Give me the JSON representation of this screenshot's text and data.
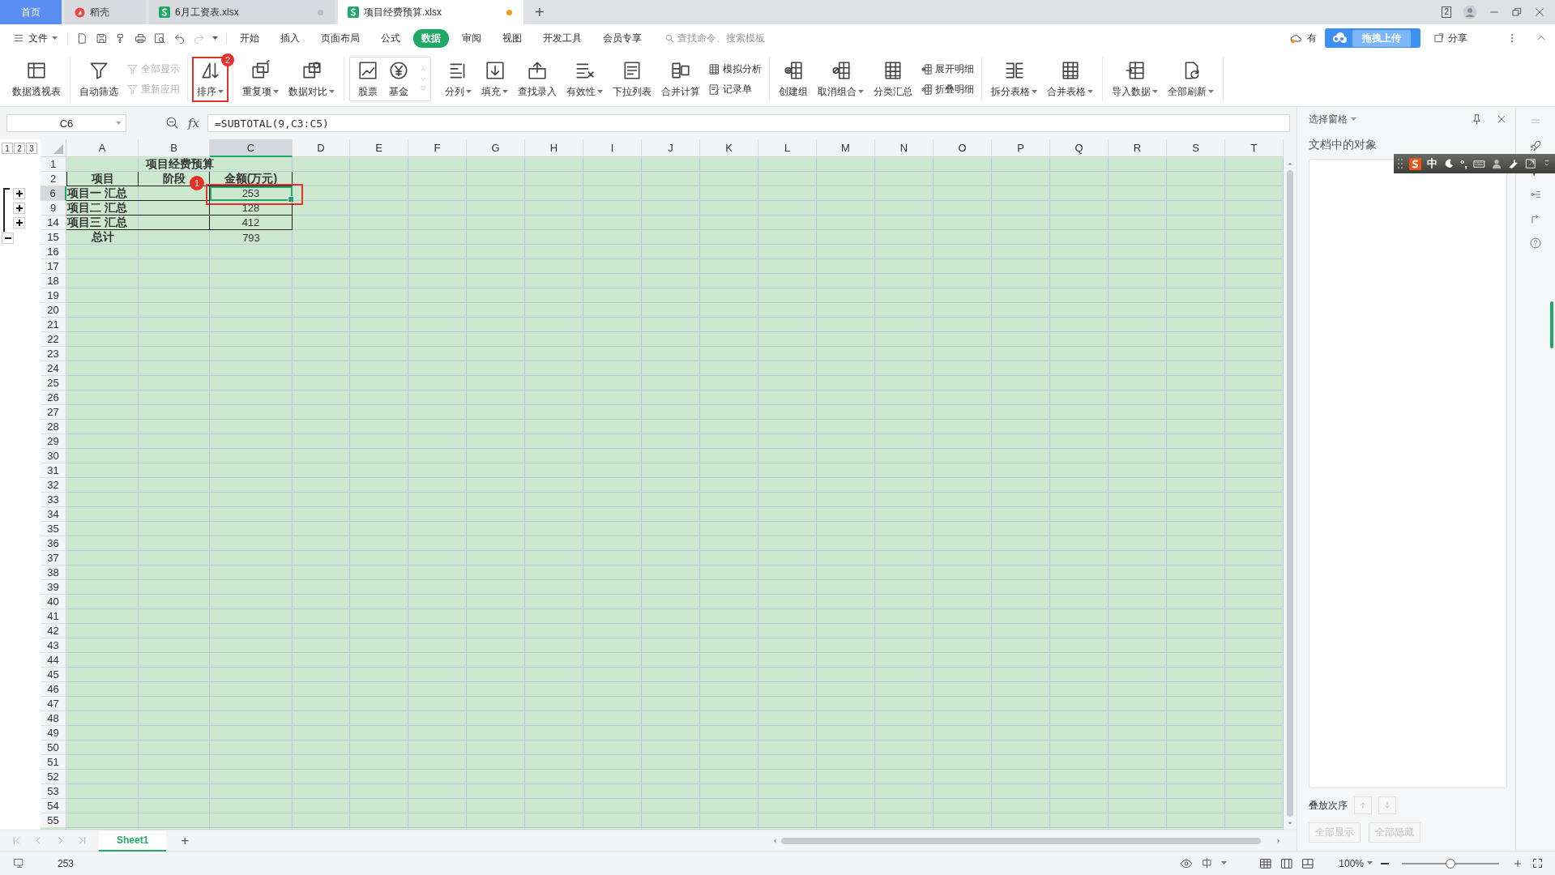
{
  "tabs": [
    {
      "label": "首页",
      "kind": "home",
      "selected": false
    },
    {
      "label": "稻壳",
      "kind": "docer",
      "selected": false
    },
    {
      "label": "6月工资表.xlsx",
      "kind": "sheet",
      "selected": false,
      "modified": false
    },
    {
      "label": "项目经费预算.xlsx",
      "kind": "sheet",
      "selected": true,
      "modified": true
    }
  ],
  "new_tab": "+",
  "window_count": "2",
  "file_menu": "文件",
  "ribbon_tabs": [
    {
      "label": "开始",
      "selected": false
    },
    {
      "label": "插入",
      "selected": false
    },
    {
      "label": "页面布局",
      "selected": false
    },
    {
      "label": "公式",
      "selected": false
    },
    {
      "label": "数据",
      "selected": true
    },
    {
      "label": "审阅",
      "selected": false
    },
    {
      "label": "视图",
      "selected": false
    },
    {
      "label": "开发工具",
      "selected": false
    },
    {
      "label": "会员专享",
      "selected": false
    }
  ],
  "search": {
    "placeholder": "查找命令、搜索模板"
  },
  "sync_status": "有",
  "upload_tip": "拖拽上传",
  "share": "分享",
  "ribbon": [
    {
      "kind": "plain",
      "items": [
        {
          "label": "数据透视表",
          "kind": "large"
        }
      ]
    },
    {
      "kind": "plain",
      "items": [
        {
          "label": "自动筛选",
          "kind": "large"
        },
        {
          "label": "全部显示",
          "kind": "small",
          "disabled": true
        },
        {
          "label": "重新应用",
          "kind": "small",
          "disabled": true
        }
      ]
    },
    {
      "kind": "plain",
      "items": [
        {
          "label": "排序",
          "kind": "large",
          "dropdown": true,
          "callout": "2"
        }
      ]
    },
    {
      "kind": "plain",
      "items": [
        {
          "label": "重复项",
          "kind": "large",
          "dropdown": true
        },
        {
          "label": "数据对比",
          "kind": "large",
          "dropdown": true
        }
      ]
    },
    {
      "kind": "gallery",
      "items": [
        {
          "label": "股票",
          "kind": "large"
        },
        {
          "label": "基金",
          "kind": "large"
        }
      ]
    },
    {
      "kind": "plain",
      "items": [
        {
          "label": "分列",
          "kind": "large",
          "dropdown": true
        },
        {
          "label": "填充",
          "kind": "large",
          "dropdown": true
        },
        {
          "label": "查找录入",
          "kind": "large"
        },
        {
          "label": "有效性",
          "kind": "large",
          "dropdown": true
        },
        {
          "label": "下拉列表",
          "kind": "large"
        },
        {
          "label": "合并计算",
          "kind": "large"
        },
        {
          "label": "模拟分析",
          "kind": "small"
        },
        {
          "label": "记录单",
          "kind": "small"
        }
      ]
    },
    {
      "kind": "plain",
      "items": [
        {
          "label": "创建组",
          "kind": "large"
        },
        {
          "label": "取消组合",
          "kind": "large",
          "dropdown": true
        },
        {
          "label": "分类汇总",
          "kind": "large"
        },
        {
          "label": "展开明细",
          "kind": "small"
        },
        {
          "label": "折叠明细",
          "kind": "small"
        }
      ]
    },
    {
      "kind": "plain",
      "items": [
        {
          "label": "拆分表格",
          "kind": "large",
          "dropdown": true
        },
        {
          "label": "合并表格",
          "kind": "large",
          "dropdown": true
        }
      ]
    },
    {
      "kind": "plain",
      "items": [
        {
          "label": "导入数据",
          "kind": "large",
          "dropdown": true
        },
        {
          "label": "全部刷新",
          "kind": "large",
          "dropdown": true
        }
      ]
    }
  ],
  "formula_bar": {
    "name_box": "C6",
    "function_label": "fx",
    "formula": "=SUBTOTAL(9,C3:C5)"
  },
  "sheet": {
    "outline_levels": [
      "1",
      "2",
      "3"
    ],
    "columns": [
      {
        "label": "A",
        "selected": false
      },
      {
        "label": "B",
        "selected": false
      },
      {
        "label": "C",
        "selected": true
      },
      {
        "label": "D",
        "selected": false
      },
      {
        "label": "E",
        "selected": false
      },
      {
        "label": "F",
        "selected": false
      },
      {
        "label": "G",
        "selected": false
      },
      {
        "label": "H",
        "selected": false
      },
      {
        "label": "I",
        "selected": false
      },
      {
        "label": "J",
        "selected": false
      },
      {
        "label": "K",
        "selected": false
      },
      {
        "label": "L",
        "selected": false
      },
      {
        "label": "M",
        "selected": false
      },
      {
        "label": "N",
        "selected": false
      },
      {
        "label": "O",
        "selected": false
      },
      {
        "label": "P",
        "selected": false
      },
      {
        "label": "Q",
        "selected": false
      },
      {
        "label": "R",
        "selected": false
      },
      {
        "label": "S",
        "selected": false
      },
      {
        "label": "T",
        "selected": false
      }
    ],
    "rows": [
      {
        "number": "1",
        "kind": "title",
        "selected": false,
        "cells": [
          "项目经费预算"
        ]
      },
      {
        "number": "2",
        "kind": "header",
        "selected": false,
        "cells": [
          "项目",
          "阶段",
          "金额(万元)"
        ]
      },
      {
        "number": "6",
        "kind": "data",
        "selected": true,
        "collapsed": true,
        "callout": "1",
        "cells": [
          "项目一  汇总",
          null,
          "253"
        ]
      },
      {
        "number": "9",
        "kind": "data",
        "selected": false,
        "collapsed": true,
        "cells": [
          "项目二  汇总",
          null,
          "128"
        ]
      },
      {
        "number": "14",
        "kind": "data",
        "selected": false,
        "collapsed": true,
        "cells": [
          "项目三  汇总",
          null,
          "412"
        ]
      },
      {
        "number": "15",
        "kind": "total",
        "selected": false,
        "collapsed": false,
        "cells": [
          "总计",
          null,
          "793"
        ]
      },
      {
        "number": "16",
        "selected": false
      },
      {
        "number": "17",
        "selected": false
      },
      {
        "number": "18",
        "selected": false
      },
      {
        "number": "19",
        "selected": false
      },
      {
        "number": "20",
        "selected": false
      },
      {
        "number": "21",
        "selected": false
      },
      {
        "number": "22",
        "selected": false
      },
      {
        "number": "23",
        "selected": false
      },
      {
        "number": "24",
        "selected": false
      },
      {
        "number": "25",
        "selected": false
      },
      {
        "number": "26",
        "selected": false
      },
      {
        "number": "27",
        "selected": false
      },
      {
        "number": "28",
        "selected": false
      },
      {
        "number": "29",
        "selected": false
      },
      {
        "number": "30",
        "selected": false
      },
      {
        "number": "31",
        "selected": false
      },
      {
        "number": "32",
        "selected": false
      },
      {
        "number": "33",
        "selected": false
      },
      {
        "number": "34",
        "selected": false
      },
      {
        "number": "35",
        "selected": false
      },
      {
        "number": "36",
        "selected": false
      },
      {
        "number": "37",
        "selected": false
      },
      {
        "number": "38",
        "selected": false
      },
      {
        "number": "39",
        "selected": false
      },
      {
        "number": "40",
        "selected": false
      },
      {
        "number": "41",
        "selected": false
      },
      {
        "number": "42",
        "selected": false
      },
      {
        "number": "43",
        "selected": false
      },
      {
        "number": "44",
        "selected": false
      },
      {
        "number": "45",
        "selected": false
      },
      {
        "number": "46",
        "selected": false
      },
      {
        "number": "47",
        "selected": false
      },
      {
        "number": "48",
        "selected": false
      },
      {
        "number": "49",
        "selected": false
      },
      {
        "number": "50",
        "selected": false
      },
      {
        "number": "51",
        "selected": false
      },
      {
        "number": "52",
        "selected": false
      },
      {
        "number": "53",
        "selected": false
      },
      {
        "number": "54",
        "selected": false
      },
      {
        "number": "55",
        "selected": false
      }
    ]
  },
  "sheet_tabs": [
    {
      "label": "Sheet1",
      "selected": true
    }
  ],
  "add_sheet": "+",
  "selection_pane": {
    "title": "选择窗格",
    "objects_label": "文档中的对象",
    "order_label": "叠放次序",
    "buttons": [
      {
        "label": "全部显示",
        "disabled": true
      },
      {
        "label": "全部隐藏",
        "disabled": true
      }
    ]
  },
  "ime": {
    "mode": "中",
    "punctuation": "°,"
  },
  "status_bar": {
    "value": "253",
    "zoom": "100%",
    "zoom_slider": {
      "level": 0.5
    }
  }
}
